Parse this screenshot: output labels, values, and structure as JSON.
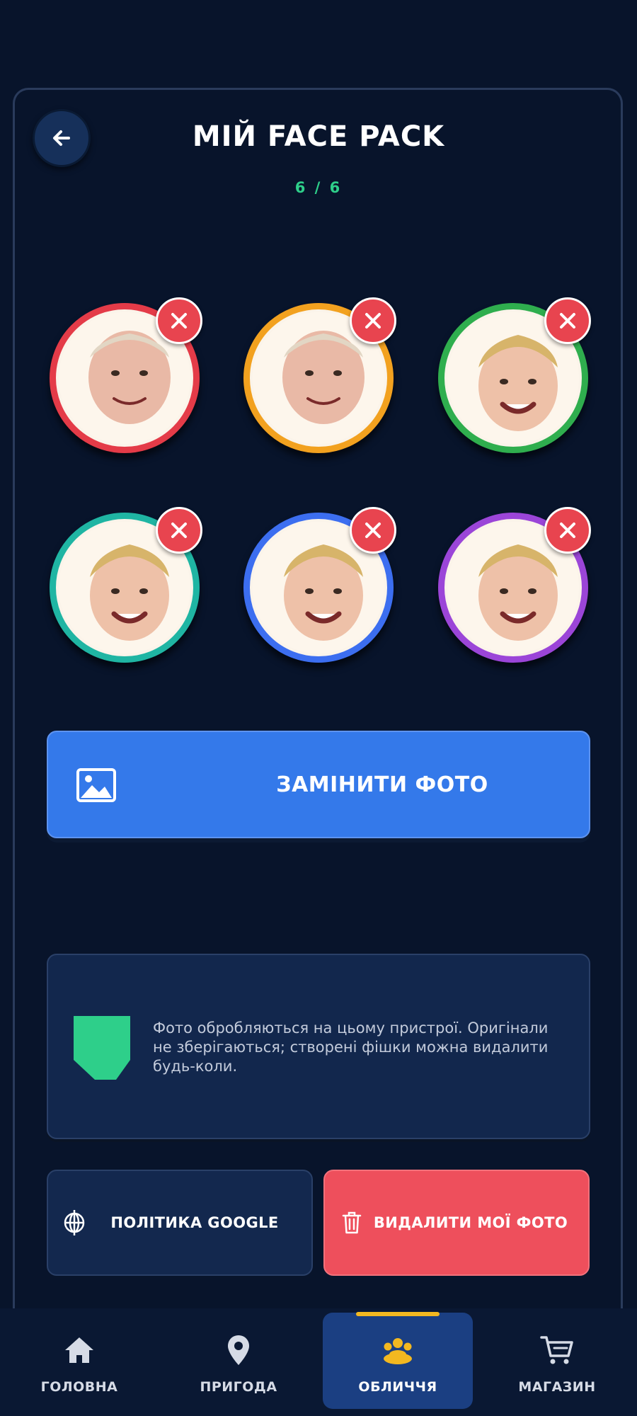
{
  "header": {
    "title": "МІЙ FACE PACK",
    "counter": "6 / 6"
  },
  "faces": [
    {
      "ring_color": "#e43b48",
      "subject": "adult-face"
    },
    {
      "ring_color": "#f2a11f",
      "subject": "adult-face"
    },
    {
      "ring_color": "#2fae4e",
      "subject": "child-face"
    },
    {
      "ring_color": "#1fb5a3",
      "subject": "child-face"
    },
    {
      "ring_color": "#3c6ef0",
      "subject": "child-face"
    },
    {
      "ring_color": "#9b45d8",
      "subject": "child-face"
    }
  ],
  "replace_button": {
    "label": "ЗАМІНИТИ ФОТО",
    "icon": "image-icon"
  },
  "privacy_note": {
    "text": "Фото обробляються на цьому пристрої. Оригінали не зберігаються; створені фішки можна видалити будь-коли.",
    "icon": "shield-icon"
  },
  "actions": {
    "google_policy": {
      "label": "ПОЛІТИКА GOOGLE",
      "icon": "globe-icon"
    },
    "delete_photos": {
      "label": "ВИДАЛИТИ МОЇ ФОТО",
      "icon": "trash-icon"
    }
  },
  "nav": {
    "items": [
      {
        "label": "ГОЛОВНА",
        "icon": "home-icon"
      },
      {
        "label": "ПРИГОДА",
        "icon": "map-pin-icon"
      },
      {
        "label": "ОБЛИЧЧЯ",
        "icon": "faces-icon",
        "active": true
      },
      {
        "label": "МАГАЗИН",
        "icon": "cart-icon"
      }
    ]
  },
  "colors": {
    "background": "#08142b",
    "accent_blue": "#3479ea",
    "danger_red": "#ee4f5c",
    "success_green": "#2ecf8a",
    "nav_active": "#1b3f82",
    "nav_indicator": "#f3b820"
  }
}
